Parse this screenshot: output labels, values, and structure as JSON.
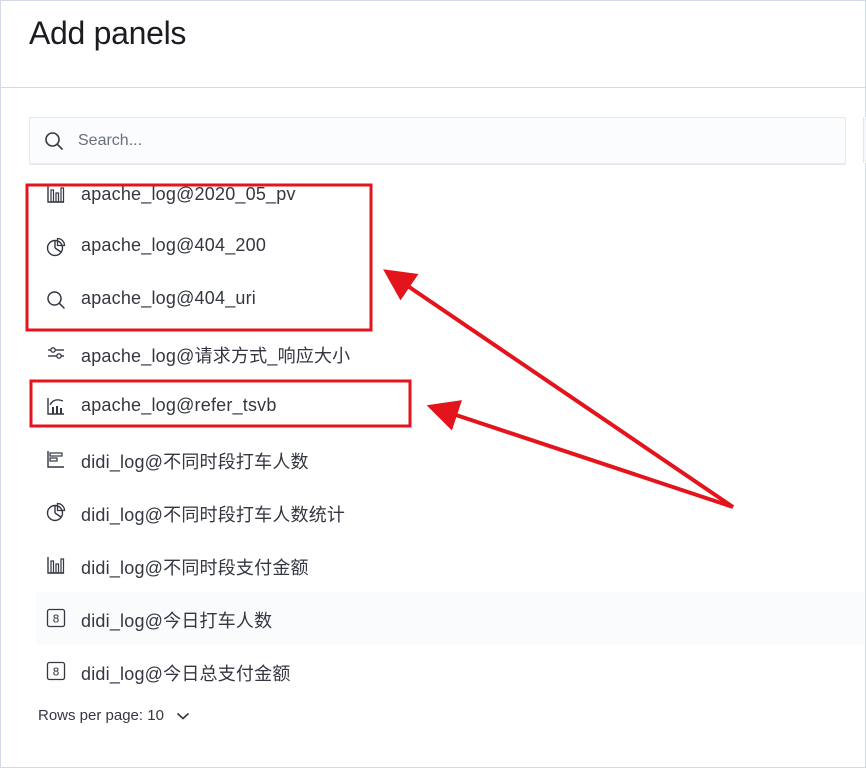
{
  "header": {
    "title": "Add panels"
  },
  "search": {
    "placeholder": "Search..."
  },
  "items": [
    {
      "label": "apache_log@2020_05_pv",
      "icon": "bar-chart-icon"
    },
    {
      "label": "apache_log@404_200",
      "icon": "pie-chart-icon"
    },
    {
      "label": "apache_log@404_uri",
      "icon": "search-icon"
    },
    {
      "label": "apache_log@请求方式_响应大小",
      "icon": "controls-icon"
    },
    {
      "label": "apache_log@refer_tsvb",
      "icon": "tsvb-icon"
    },
    {
      "label": "didi_log@不同时段打车人数",
      "icon": "horizontal-bar-icon"
    },
    {
      "label": "didi_log@不同时段打车人数统计",
      "icon": "pie-chart-icon"
    },
    {
      "label": "didi_log@不同时段支付金额",
      "icon": "bar-chart-icon"
    },
    {
      "label": "didi_log@今日打车人数",
      "icon": "metric-icon"
    },
    {
      "label": "didi_log@今日总支付金额",
      "icon": "metric-icon"
    }
  ],
  "pagination": {
    "rows_per_page": "Rows per page: 10"
  },
  "colors": {
    "annotation": "#e3141c",
    "accent": "#343741"
  }
}
